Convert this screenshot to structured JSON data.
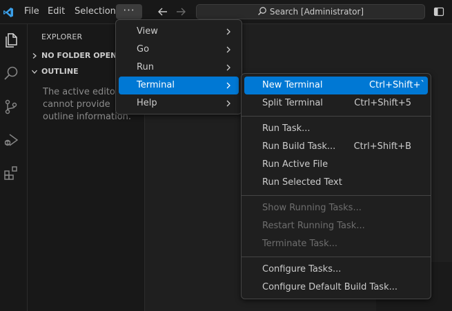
{
  "titlebar": {
    "menus": [
      "File",
      "Edit",
      "Selection"
    ],
    "more_label": "···",
    "search_text": "Search [Administrator]"
  },
  "sidebar": {
    "title": "EXPLORER",
    "no_folder": "NO FOLDER OPENED",
    "outline": "OUTLINE",
    "outline_message": "The active editor cannot provide outline information."
  },
  "main_menu": {
    "items": [
      {
        "label": "View"
      },
      {
        "label": "Go"
      },
      {
        "label": "Run"
      },
      {
        "label": "Terminal"
      },
      {
        "label": "Help"
      }
    ],
    "active_item": "Terminal"
  },
  "terminal_menu": {
    "items": [
      {
        "label": "New Terminal",
        "shortcut": "Ctrl+Shift+`"
      },
      {
        "label": "Split Terminal",
        "shortcut": "Ctrl+Shift+5"
      },
      {
        "label": "Run Task...",
        "shortcut": ""
      },
      {
        "label": "Run Build Task...",
        "shortcut": "Ctrl+Shift+B"
      },
      {
        "label": "Run Active File",
        "shortcut": ""
      },
      {
        "label": "Run Selected Text",
        "shortcut": ""
      },
      {
        "label": "Show Running Tasks...",
        "shortcut": ""
      },
      {
        "label": "Restart Running Task...",
        "shortcut": ""
      },
      {
        "label": "Terminate Task...",
        "shortcut": ""
      },
      {
        "label": "Configure Tasks...",
        "shortcut": ""
      },
      {
        "label": "Configure Default Build Task...",
        "shortcut": ""
      }
    ],
    "highlighted_item": "New Terminal",
    "disabled_items": [
      "Show Running Tasks...",
      "Restart Running Task...",
      "Terminate Task..."
    ]
  },
  "colors": {
    "accent": "#0078d4",
    "logo": "#3b9fe8"
  }
}
